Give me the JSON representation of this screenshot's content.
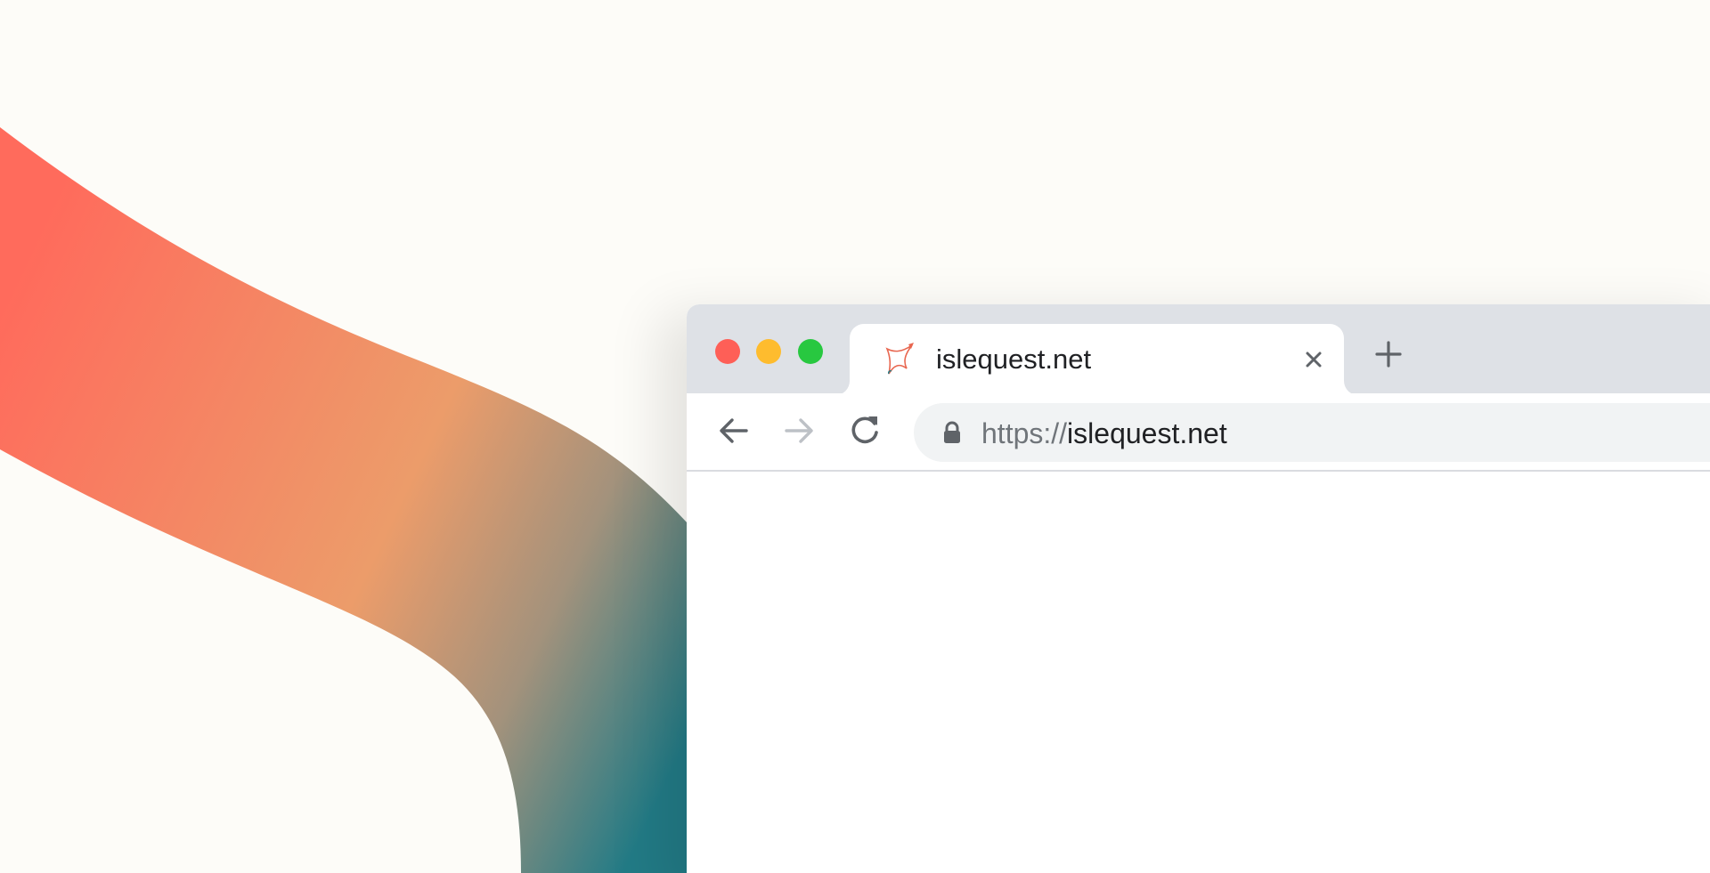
{
  "window": {
    "controls": [
      "close",
      "minimize",
      "maximize"
    ],
    "colors": {
      "close": "#fe5f57",
      "minimize": "#febc2e",
      "maximize": "#28c840"
    }
  },
  "tab": {
    "title": "islequest.net",
    "favicon": "islequest-star-logo-icon",
    "close_icon": "close-icon"
  },
  "new_tab_icon": "plus-icon",
  "toolbar": {
    "back_icon": "arrow-left-icon",
    "forward_icon": "arrow-right-icon",
    "reload_icon": "reload-icon"
  },
  "address_bar": {
    "lock_icon": "lock-icon",
    "scheme": "https://",
    "host": "islequest.net"
  },
  "background": {
    "ribbon_colors": [
      "#ff6b5c",
      "#ec9c6a",
      "#a3927c",
      "#227b86"
    ]
  }
}
